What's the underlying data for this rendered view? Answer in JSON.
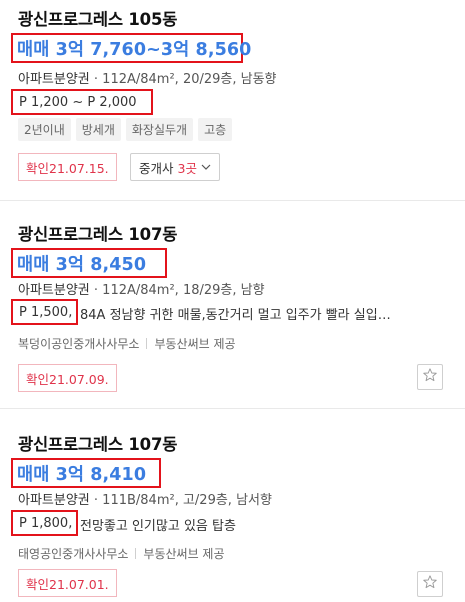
{
  "listings": [
    {
      "title": "광신프로그레스 105동",
      "price": "매매 3억 7,760~3억 8,560",
      "type": "아파트분양권",
      "spec": "112A/84m², 20/29층, 남동향",
      "premium": "P 1,200 ~ P 2,000",
      "tags": [
        "2년이내",
        "방세개",
        "화장실두개",
        "고층"
      ],
      "confirm": "확인21.07.15.",
      "agents": {
        "label": "중개사",
        "count": "3곳"
      }
    },
    {
      "title": "광신프로그레스 107동",
      "price": "매매 3억 8,450",
      "type": "아파트분양권",
      "spec": "112A/84m², 18/29층, 남향",
      "premium": "P 1,500,",
      "memo": "84A 정남향 귀한 매물,동간거리 멀고 입주가 빨라 실입…",
      "agency": "복덩이공인중개사사무소",
      "provider": "부동산써브 제공",
      "confirm": "확인21.07.09."
    },
    {
      "title": "광신프로그레스 107동",
      "price": "매매 3억 8,410",
      "type": "아파트분양권",
      "spec": "111B/84m², 고/29층, 남서향",
      "premium": "P 1,800,",
      "memo": "전망좋고 인기많고 있음 탑층",
      "agency": "태영공인중개사사무소",
      "provider": "부동산써브 제공",
      "confirm": "확인21.07.01."
    }
  ],
  "icons": {
    "dropdown": "chevron-down-icon",
    "favorite": "star-outline-icon"
  },
  "colors": {
    "price": "#3b7de0",
    "highlight": "#e3131b",
    "confirm": "#e0344b"
  }
}
